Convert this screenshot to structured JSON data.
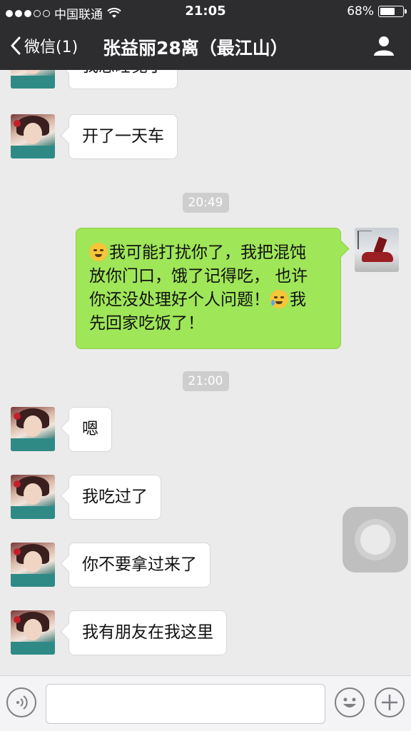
{
  "status_bar": {
    "carrier": "中国联通",
    "time": "21:05",
    "battery": "68%",
    "battery_level": 0.68
  },
  "nav": {
    "back_label": "微信(1)",
    "title": "张益丽28离（最江山）"
  },
  "messages": [
    {
      "side": "left",
      "text": "我想睡觉了"
    },
    {
      "side": "left",
      "text": "开了一天车"
    },
    {
      "type": "time",
      "text": "20:49"
    },
    {
      "side": "right",
      "line1": "我可能打扰你了，我把混饨",
      "line2": "放你门口，饿了记得吃， 也许",
      "line3a": "你还没处理好个人问题！",
      "line3b": "我",
      "line4": "先回家吃饭了！"
    },
    {
      "type": "time",
      "text": "21:00"
    },
    {
      "side": "left",
      "text": "嗯"
    },
    {
      "side": "left",
      "text": "我吃过了"
    },
    {
      "side": "left",
      "text": "你不要拿过来了"
    },
    {
      "side": "left",
      "text": "我有朋友在我这里"
    }
  ],
  "input": {
    "value": ""
  },
  "icons": {
    "voice": "voice-icon",
    "emoji": "emoji-icon",
    "plus": "plus-icon",
    "profile": "profile-icon",
    "back": "chevron-left-icon"
  },
  "colors": {
    "header_bg": "#2d2d30",
    "chat_bg": "#ebebeb",
    "sent_bubble": "#9fe658"
  }
}
